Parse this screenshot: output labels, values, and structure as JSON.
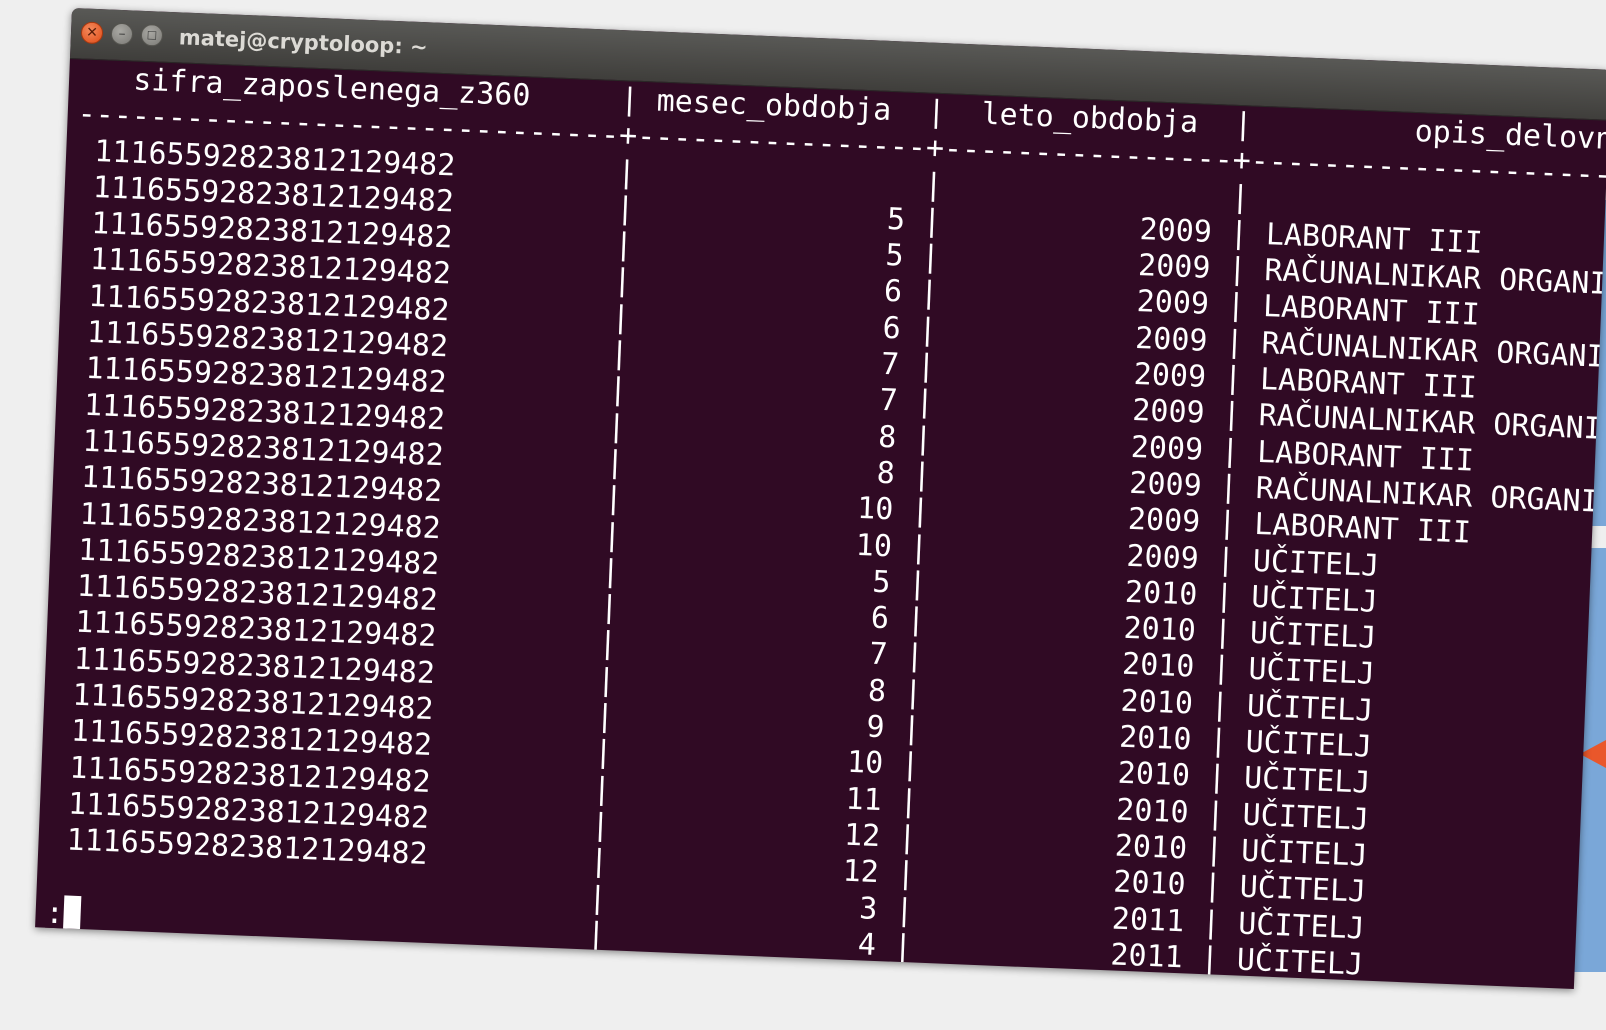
{
  "window": {
    "title": "matej@cryptoloop: ~"
  },
  "columns": {
    "c1": "sifra_zaposlenega_z360",
    "c2": "mesec_obdobja",
    "c3": "leto_obdobja",
    "c4": "opis_delovneg"
  },
  "rows": [
    {
      "c1": "111655928238121294​82",
      "c2": "",
      "c3": "",
      "c4": ""
    },
    {
      "c1": "11165592823812129482",
      "c2": "5",
      "c3": "2009",
      "c4": "LABORANT III"
    },
    {
      "c1": "11165592823812129482",
      "c2": "5",
      "c3": "2009",
      "c4": "RAČUNALNIKAR ORGANIZATO"
    },
    {
      "c1": "11165592823812129482",
      "c2": "6",
      "c3": "2009",
      "c4": "LABORANT III"
    },
    {
      "c1": "11165592823812129482",
      "c2": "6",
      "c3": "2009",
      "c4": "RAČUNALNIKAR ORGANIZATO"
    },
    {
      "c1": "11165592823812129482",
      "c2": "7",
      "c3": "2009",
      "c4": "LABORANT III"
    },
    {
      "c1": "11165592823812129482",
      "c2": "7",
      "c3": "2009",
      "c4": "RAČUNALNIKAR ORGANIZATO"
    },
    {
      "c1": "11165592823812129482",
      "c2": "8",
      "c3": "2009",
      "c4": "LABORANT III"
    },
    {
      "c1": "11165592823812129482",
      "c2": "8",
      "c3": "2009",
      "c4": "RAČUNALNIKAR ORGANIZATO"
    },
    {
      "c1": "11165592823812129482",
      "c2": "10",
      "c3": "2009",
      "c4": "LABORANT III"
    },
    {
      "c1": "11165592823812129482",
      "c2": "10",
      "c3": "2009",
      "c4": "UČITELJ"
    },
    {
      "c1": "11165592823812129482",
      "c2": "5",
      "c3": "2010",
      "c4": "UČITELJ"
    },
    {
      "c1": "11165592823812129482",
      "c2": "6",
      "c3": "2010",
      "c4": "UČITELJ"
    },
    {
      "c1": "11165592823812129482",
      "c2": "7",
      "c3": "2010",
      "c4": "UČITELJ"
    },
    {
      "c1": "11165592823812129482",
      "c2": "8",
      "c3": "2010",
      "c4": "UČITELJ"
    },
    {
      "c1": "11165592823812129482",
      "c2": "9",
      "c3": "2010",
      "c4": "UČITELJ"
    },
    {
      "c1": "11165592823812129482",
      "c2": "10",
      "c3": "2010",
      "c4": "UČITELJ"
    },
    {
      "c1": "11165592823812129482",
      "c2": "11",
      "c3": "2010",
      "c4": "UČITELJ"
    },
    {
      "c1": "11165592823812129482",
      "c2": "12",
      "c3": "2010",
      "c4": "UČITELJ"
    },
    {
      "c1": "11165592823812129482",
      "c2": "12",
      "c3": "2010",
      "c4": "UČITELJ"
    },
    {
      "c1": "",
      "c2": "3",
      "c3": "2011",
      "c4": "UČITELJ"
    },
    {
      "c1": "",
      "c2": "4",
      "c3": "2011",
      "c4": "UČITELJ"
    }
  ],
  "prompt": ":",
  "colors": {
    "terminal_bg": "#300a24",
    "terminal_fg": "#ffffff",
    "titlebar": "#4a4946",
    "close_button": "#df4b16",
    "side_bar": "#7aa7d8",
    "side_arrow": "#e9572b"
  }
}
